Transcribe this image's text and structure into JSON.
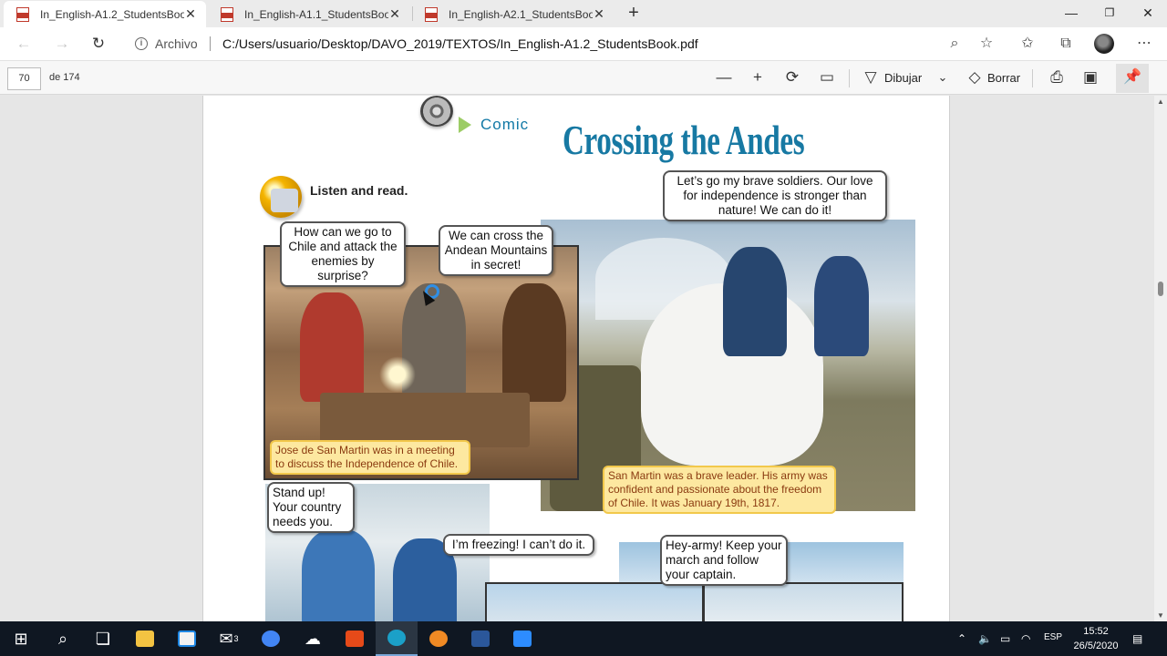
{
  "browser": {
    "tabs": [
      {
        "label": "In_English-A1.2_StudentsBook.pdf",
        "active": true
      },
      {
        "label": "In_English-A1.1_StudentsBook(1).pdf",
        "active": false
      },
      {
        "label": "In_English-A2.1_StudentsBook.pdf",
        "active": false
      }
    ],
    "site_label": "Archivo",
    "url": "C:/Users/usuario/Desktop/DAVO_2019/TEXTOS/In_English-A1.2_StudentsBook.pdf"
  },
  "pdf_toolbar": {
    "page_current": "70",
    "page_total": "de 174",
    "draw_label": "Dibujar",
    "erase_label": "Borrar"
  },
  "comic": {
    "section_tag": "Comic",
    "title": "Crossing the Andes",
    "instruction": "Listen and read.",
    "bubble1": "How can we go to Chile and attack the enemies by surprise?",
    "bubble2": "We can cross the Andean Mountains in secret!",
    "bubble3": "Let’s go my brave soldiers. Our love for independence is stronger than nature! We can do it!",
    "caption1": "Jose de San Martin was in a meeting to discuss the Independence of Chile.",
    "caption2": "San Martin was a brave leader. His army was confident and passionate about the freedom of Chile. It was January 19th, 1817.",
    "bubble4": "Stand up! Your country needs you.",
    "bubble5": "I’m freezing! I can’t do it.",
    "bubble6": "Hey-army! Keep your march and follow your captain."
  },
  "taskbar": {
    "mail_badge": "3",
    "language": "ESP",
    "time": "15:52",
    "date": "26/5/2020"
  },
  "colors": {
    "title_blue": "#1779a3",
    "caption_bg": "#fde8a0",
    "taskbar_bg": "#0f1722"
  }
}
